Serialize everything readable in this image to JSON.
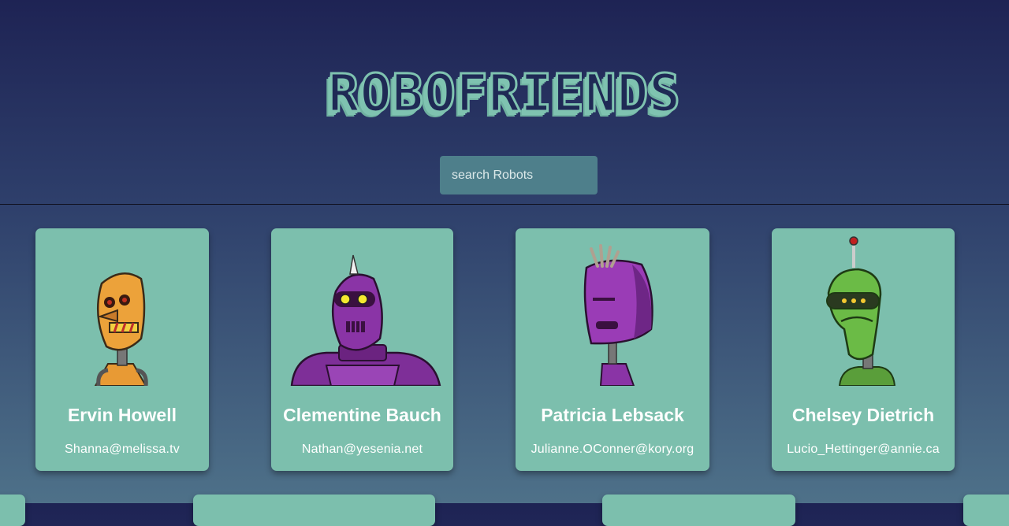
{
  "app": {
    "title": "ROBOFRIENDS"
  },
  "search": {
    "placeholder": "search Robots",
    "value": ""
  },
  "colors": {
    "card": "#7cbfad",
    "search": "#4e7f8b",
    "title_fill": "#1f2a55",
    "title_accent": "#7fc3b0"
  },
  "robots": [
    {
      "name": "Ervin Howell",
      "email": "Shanna@melissa.tv",
      "icon": "robot-avatar-orange"
    },
    {
      "name": "Clementine Bauch",
      "email": "Nathan@yesenia.net",
      "icon": "robot-avatar-purple-horn"
    },
    {
      "name": "Patricia Lebsack",
      "email": "Julianne.OConner@kory.org",
      "icon": "robot-avatar-purple-tuft"
    },
    {
      "name": "Chelsey Dietrich",
      "email": "Lucio_Hettinger@annie.ca",
      "icon": "robot-avatar-green-antenna"
    }
  ]
}
